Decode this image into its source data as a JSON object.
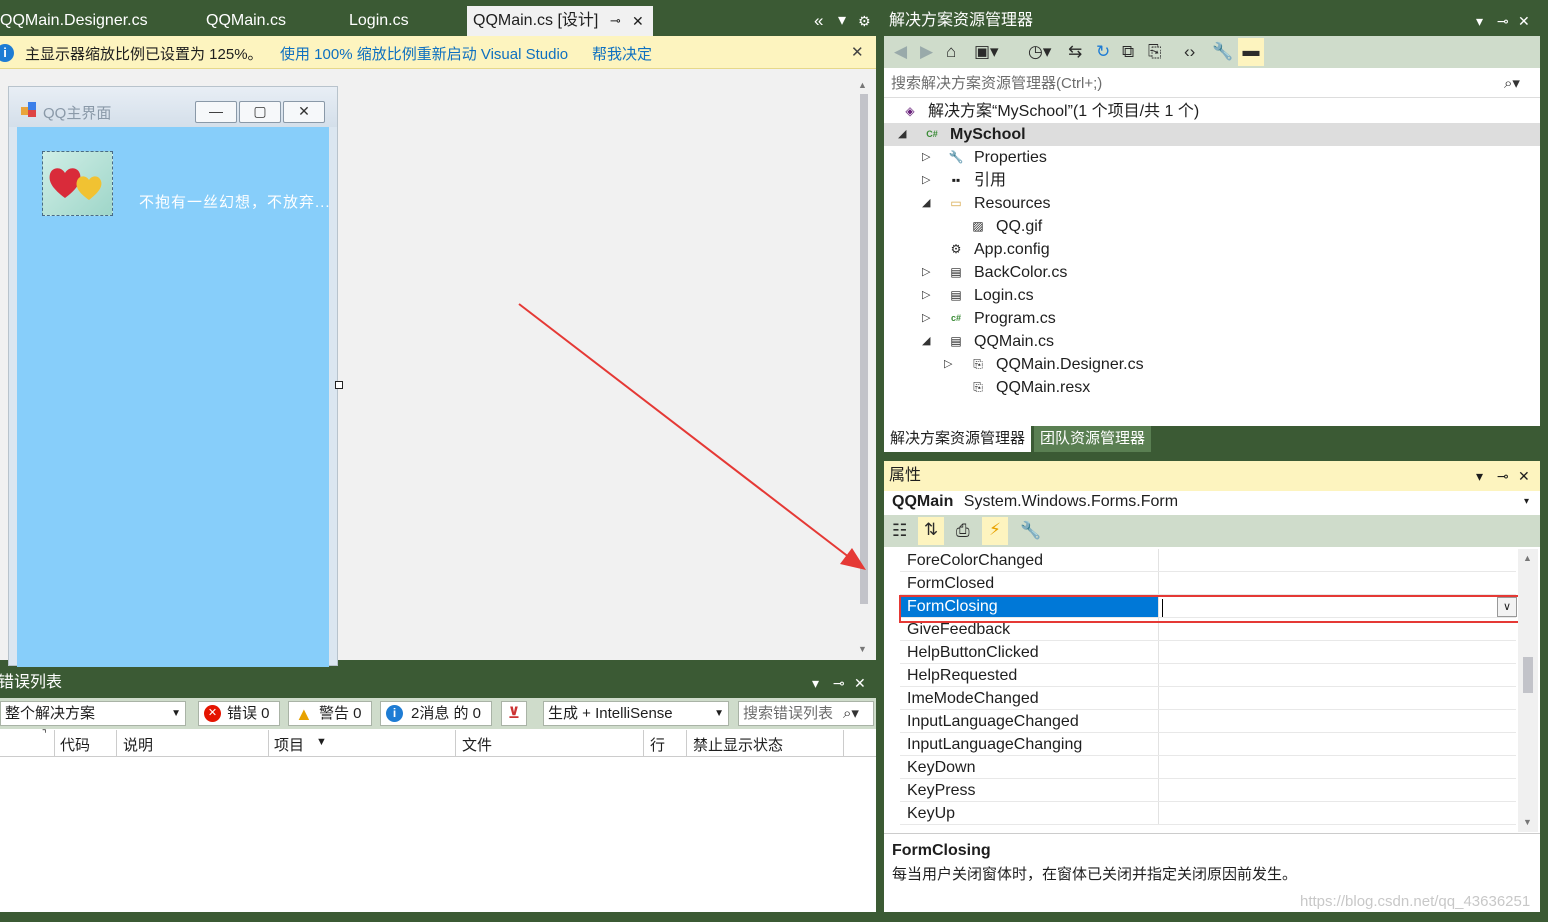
{
  "editor": {
    "tabs": [
      {
        "label": "QQMain.Designer.cs"
      },
      {
        "label": "QQMain.cs"
      },
      {
        "label": "Login.cs"
      },
      {
        "label": "QQMain.cs [设计]"
      }
    ],
    "pin_glyph": "⊸",
    "close_glyph": "✕",
    "overflow_glyph": "«",
    "dropdown_glyph": "▾",
    "settings_glyph": "⚙"
  },
  "infobar": {
    "message": "主显示器缩放比例已设置为 125%。",
    "restart_link": "使用 100% 缩放比例重新启动 Visual Studio",
    "help_link": "帮我决定",
    "close_glyph": "✕"
  },
  "designer": {
    "form_title": "QQ主界面",
    "min_glyph": "—",
    "max_glyph": "▢",
    "close_glyph": "✕",
    "label_text": "不抱有一丝幻想，不放弃...",
    "arrow_color": "#e53935"
  },
  "error_list": {
    "title": "错误列表",
    "scope": "整个解决方案",
    "errors": "错误 0",
    "warnings": "警告 0",
    "messages": "2消息 的 0",
    "build_filter": "生成 + IntelliSense",
    "search_placeholder": "搜索错误列表",
    "columns": [
      "代码",
      "说明",
      "项目",
      "文件",
      "行",
      "禁止显示状态"
    ]
  },
  "solution_explorer": {
    "title": "解决方案资源管理器",
    "search_placeholder": "搜索解决方案资源管理器(Ctrl+;)",
    "tree": [
      {
        "label": "解决方案“MySchool”(1 个项目/共 1 个)",
        "icon": "solution-icon",
        "expander": ""
      },
      {
        "label": "MySchool",
        "icon": "csharp-project-icon",
        "expander": "◢",
        "selected": true
      },
      {
        "label": "Properties",
        "icon": "wrench-icon",
        "expander": "▷"
      },
      {
        "label": "引用",
        "icon": "references-icon",
        "expander": "▷"
      },
      {
        "label": "Resources",
        "icon": "folder-icon",
        "expander": "◢"
      },
      {
        "label": "QQ.gif",
        "icon": "image-file-icon",
        "expander": ""
      },
      {
        "label": "App.config",
        "icon": "config-file-icon",
        "expander": ""
      },
      {
        "label": "BackColor.cs",
        "icon": "form-file-icon",
        "expander": "▷"
      },
      {
        "label": "Login.cs",
        "icon": "form-file-icon",
        "expander": "▷"
      },
      {
        "label": "Program.cs",
        "icon": "csharp-file-icon",
        "expander": "▷"
      },
      {
        "label": "QQMain.cs",
        "icon": "form-file-icon",
        "expander": "◢"
      },
      {
        "label": "QQMain.Designer.cs",
        "icon": "code-file-icon",
        "expander": "▷"
      },
      {
        "label": "QQMain.resx",
        "icon": "resx-file-icon",
        "expander": ""
      }
    ],
    "bottom_tabs": [
      "解决方案资源管理器",
      "团队资源管理器"
    ]
  },
  "properties": {
    "title": "属性",
    "object_name": "QQMain",
    "object_type": "System.Windows.Forms.Form",
    "rows": [
      {
        "name": "ForeColorChanged"
      },
      {
        "name": "FormClosed"
      },
      {
        "name": "FormClosing",
        "selected": true
      },
      {
        "name": "GiveFeedback"
      },
      {
        "name": "HelpButtonClicked"
      },
      {
        "name": "HelpRequested"
      },
      {
        "name": "ImeModeChanged"
      },
      {
        "name": "InputLanguageChanged"
      },
      {
        "name": "InputLanguageChanging"
      },
      {
        "name": "KeyDown"
      },
      {
        "name": "KeyPress"
      },
      {
        "name": "KeyUp"
      }
    ],
    "desc_title": "FormClosing",
    "desc_text": "每当用户关闭窗体时，在窗体已关闭并指定关闭原因前发生。",
    "highlight_color": "#e53935"
  },
  "watermark": "https://blog.csdn.net/qq_43636251"
}
